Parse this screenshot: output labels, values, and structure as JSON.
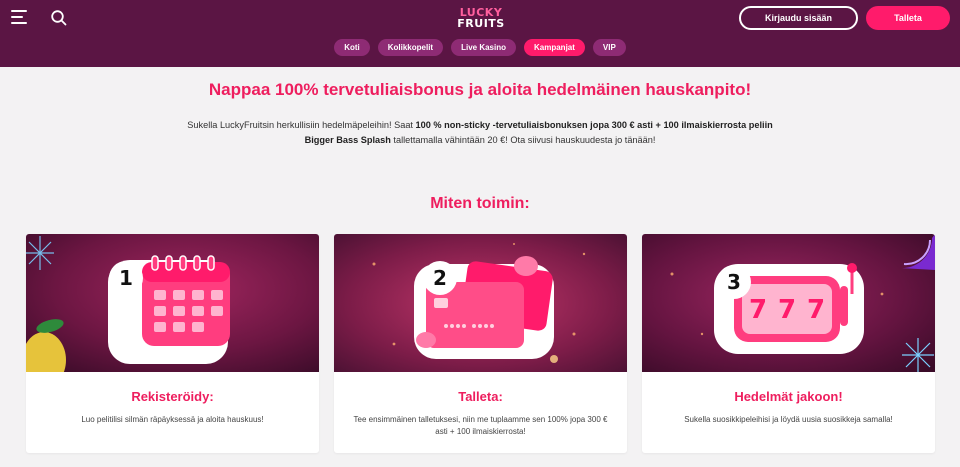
{
  "header": {
    "logo_line1": "LUCKY",
    "logo_line2": "FRUITS",
    "login_label": "Kirjaudu sisään",
    "deposit_label": "Talleta"
  },
  "nav": {
    "items": [
      {
        "label": "Koti"
      },
      {
        "label": "Kolikkopelit"
      },
      {
        "label": "Live Kasino"
      },
      {
        "label": "Kampanjat"
      },
      {
        "label": "VIP"
      }
    ],
    "active": "Kampanjat"
  },
  "main": {
    "headline": "Nappaa 100% tervetuliaisbonus ja aloita hedelmäinen hauskanpito!",
    "intro": {
      "part1": "Sukella LuckyFruitsin herkullisiin hedelmäpeleihin! Saat ",
      "bold1": "100 % non-sticky -tervetuliaisbonuksen jopa 300 € asti + 100 ilmaiskierrosta peliin",
      "bold2": "Bigger Bass Splash",
      "part2": " tallettamalla vähintään 20 €! Ota siivusi hauskuudesta jo tänään!"
    },
    "section_title": "Miten toimin:",
    "steps": [
      {
        "number": "1",
        "title": "Rekisteröidy:",
        "text": "Luo pelitilisi silmän räpäyksessä ja aloita hauskuus!"
      },
      {
        "number": "2",
        "title": "Talleta:",
        "text": "Tee ensimmäinen talletuksesi, niin me tuplaamme sen 100% jopa 300 € asti + 100 ilmaiskierrosta!"
      },
      {
        "number": "3",
        "title": "Hedelmät jakoon!",
        "text": "Sukella suosikkipeleihisi ja löydä uusia suosikkeja samalla!"
      }
    ]
  },
  "colors": {
    "header_bg": "#5b1544",
    "accent": "#ff1b6b",
    "title_red": "#ee1e5e",
    "pill": "#8e2b74"
  }
}
